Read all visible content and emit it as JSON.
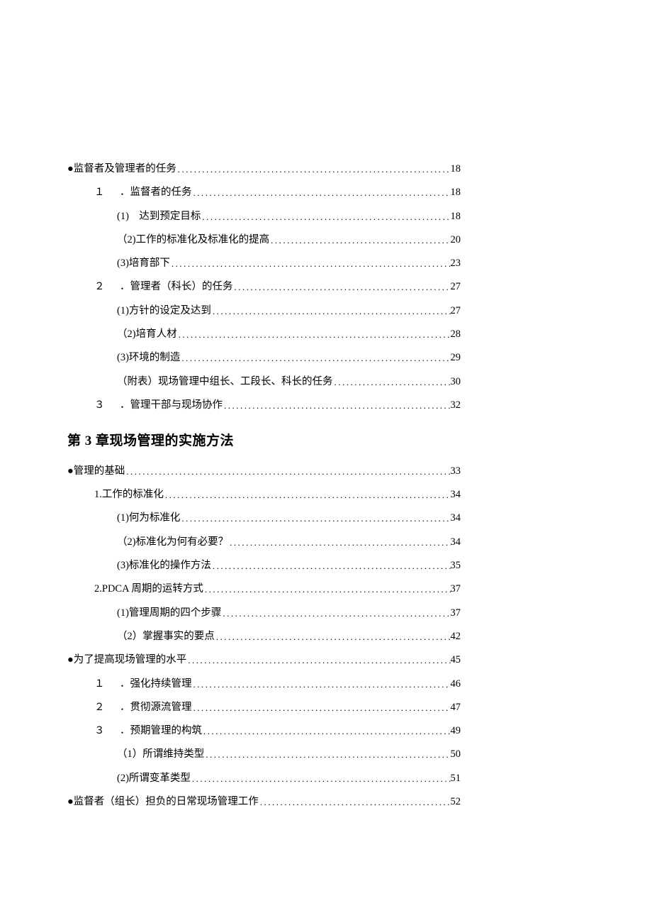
{
  "sections": [
    {
      "indent": 0,
      "text": "●监督者及管理者的任务",
      "page": "18"
    },
    {
      "indent": 1,
      "marker": "１",
      "sep": "．",
      "text": "监督者的任务",
      "page": "18",
      "markerGap": true
    },
    {
      "indent": 2,
      "text": "(1)　达到预定目标",
      "page": "18"
    },
    {
      "indent": 2,
      "text": "（2)工作的标准化及标准化的提高",
      "page": "20"
    },
    {
      "indent": 2,
      "text": "(3)培育部下",
      "page": "23"
    },
    {
      "indent": 1,
      "marker": "２",
      "sep": "．",
      "text": "管理者（科长）的任务",
      "page": "27",
      "markerGap": true
    },
    {
      "indent": 2,
      "text": "(1)方针的设定及达到",
      "page": "27"
    },
    {
      "indent": 2,
      "text": "（2)培育人材",
      "page": "28"
    },
    {
      "indent": 2,
      "text": "(3)环境的制造",
      "page": "29"
    },
    {
      "indent": 2,
      "text": "（附表）现场管理中组长、工段长、科长的任务",
      "page": "30"
    },
    {
      "indent": 1,
      "marker": "３",
      "sep": "．",
      "text": "管理干部与现场协作",
      "page": "32",
      "markerGap": true
    }
  ],
  "chapter": {
    "prefix": "第",
    "number": "3",
    "suffix": "章",
    "title": "现场管理的实施方法"
  },
  "sections2": [
    {
      "indent": 0,
      "text": "●管理的基础",
      "page": "33"
    },
    {
      "indent": 1,
      "text": "1.工作的标准化",
      "page": "34"
    },
    {
      "indent": 2,
      "text": "(1)何为标准化",
      "page": "34"
    },
    {
      "indent": 2,
      "text": "（2)标准化为何有必要？",
      "page": "34"
    },
    {
      "indent": 2,
      "text": "(3)标准化的操作方法",
      "page": "35"
    },
    {
      "indent": 1,
      "text": "2.PDCA 周期的运转方式",
      "page": "37"
    },
    {
      "indent": 2,
      "text": "(1)管理周期的四个步骤",
      "page": "37"
    },
    {
      "indent": 2,
      "text": "（2）掌握事实的要点",
      "page": "42"
    },
    {
      "indent": 0,
      "text": "●为了提高现场管理的水平",
      "page": "45"
    },
    {
      "indent": 1,
      "marker": "１",
      "sep": "．",
      "text": "强化持续管理",
      "page": "46",
      "markerGap": true
    },
    {
      "indent": 1,
      "marker": "２",
      "sep": "．",
      "text": "贯彻源流管理",
      "page": "47",
      "markerGap": true
    },
    {
      "indent": 1,
      "marker": "３",
      "sep": "．",
      "text": "预期管理的构筑",
      "page": "49",
      "markerGap": true
    },
    {
      "indent": 2,
      "text": "（1）所谓维持类型",
      "page": "50"
    },
    {
      "indent": 2,
      "text": "(2)所谓变革类型",
      "page": "51"
    },
    {
      "indent": 0,
      "text": "●监督者（组长）担负的日常现场管理工作",
      "page": "52"
    }
  ],
  "padRight": 555
}
